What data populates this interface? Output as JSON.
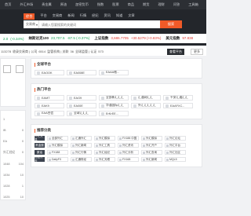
{
  "topnav": [
    "首页",
    "外汇市场",
    "贵金属",
    "原油",
    "加密货币",
    "指数",
    "股票",
    "商品",
    "期货",
    "理财",
    "问答",
    "工具箱"
  ],
  "hero": {
    "tabs": [
      "综合",
      "平台",
      "交易商",
      "新闻",
      "行情",
      "经纪",
      "资讯",
      "知道",
      "文章"
    ],
    "search_scope": "交易商",
    "search_placeholder": "请输入您要搜索的关键词",
    "search_button": "搜索"
  },
  "ticker": [
    {
      "name": "",
      "price": "2.0",
      "change": "(-0.34%)",
      "dir": "down"
    },
    {
      "name": "纳斯达克100",
      "price": "23,707.5",
      "change": "-87.5 (-0.37%)",
      "dir": "down"
    },
    {
      "name": "上证指数",
      "price": "3,686.7705",
      "change": "+30.5279 (+0.83%)",
      "dir": "up"
    },
    {
      "name": "美元指数",
      "price": "97.838",
      "change": "",
      "dir": "up"
    }
  ],
  "stats": {
    "text1": "113278",
    "text2": "收录交易商 | 公司",
    "text3": "6514",
    "text4": "监管机构 | 关联",
    "text5": "36",
    "text6": "全球监管 | 认证",
    "text7": "573",
    "dark_button": "查看平台",
    "light_button": "更多"
  },
  "left_list": [
    {
      "label": "1",
      "value": ""
    },
    {
      "label": "IB",
      "value": "0"
    },
    {
      "label": "EA",
      "value": "0"
    },
    {
      "label": "外汇经纪",
      "value": "0"
    },
    {
      "label": "1048",
      "value": "104"
    },
    {
      "label": "1034",
      "value": "10"
    },
    {
      "label": "1028",
      "value": "1"
    },
    {
      "label": "1025",
      "value": "10"
    }
  ],
  "featured": {
    "title": "全球平台",
    "chips": [
      "EAOOK",
      "EA008E",
      "EAAA格..."
    ]
  },
  "recommended": {
    "title": "热门平台",
    "chips": [
      "EAMT",
      "EAG9",
      "全部新汇汇汇",
      "汇通网汇汇",
      "平安汇通汇汇",
      "EAK9",
      "EA00E",
      "华通国际汇汇",
      "外汇汇汇汇汇",
      "EAAFXC...",
      "EAA合信",
      "全球汇汇汇",
      "ErKrEE..."
    ]
  },
  "categories": {
    "title": "推荐分类",
    "rows": [
      {
        "tag": "外汇交易",
        "items": [
          "全部外汇",
          "汇通外汇",
          "外汇模拟",
          "FX188 中国",
          "外汇模拟",
          "外汇论坛"
        ]
      },
      {
        "tag": "贵金属",
        "items": [
          "外汇模拟",
          "外汇新闻",
          "外汇工具",
          "外汇资讯",
          "外汇开户",
          "外汇平台"
        ]
      },
      {
        "tag": "原油",
        "items": [
          "FX188",
          "外汇行情",
          "外汇经纪",
          "外汇分析",
          "外汇查询",
          "外汇社区"
        ]
      },
      {
        "tag": "加密货币",
        "items": [
          "DailyFX",
          "汇通财经",
          "外汇天眼",
          "FX168",
          "外汇新闻",
          "MQL5"
        ]
      }
    ]
  }
}
